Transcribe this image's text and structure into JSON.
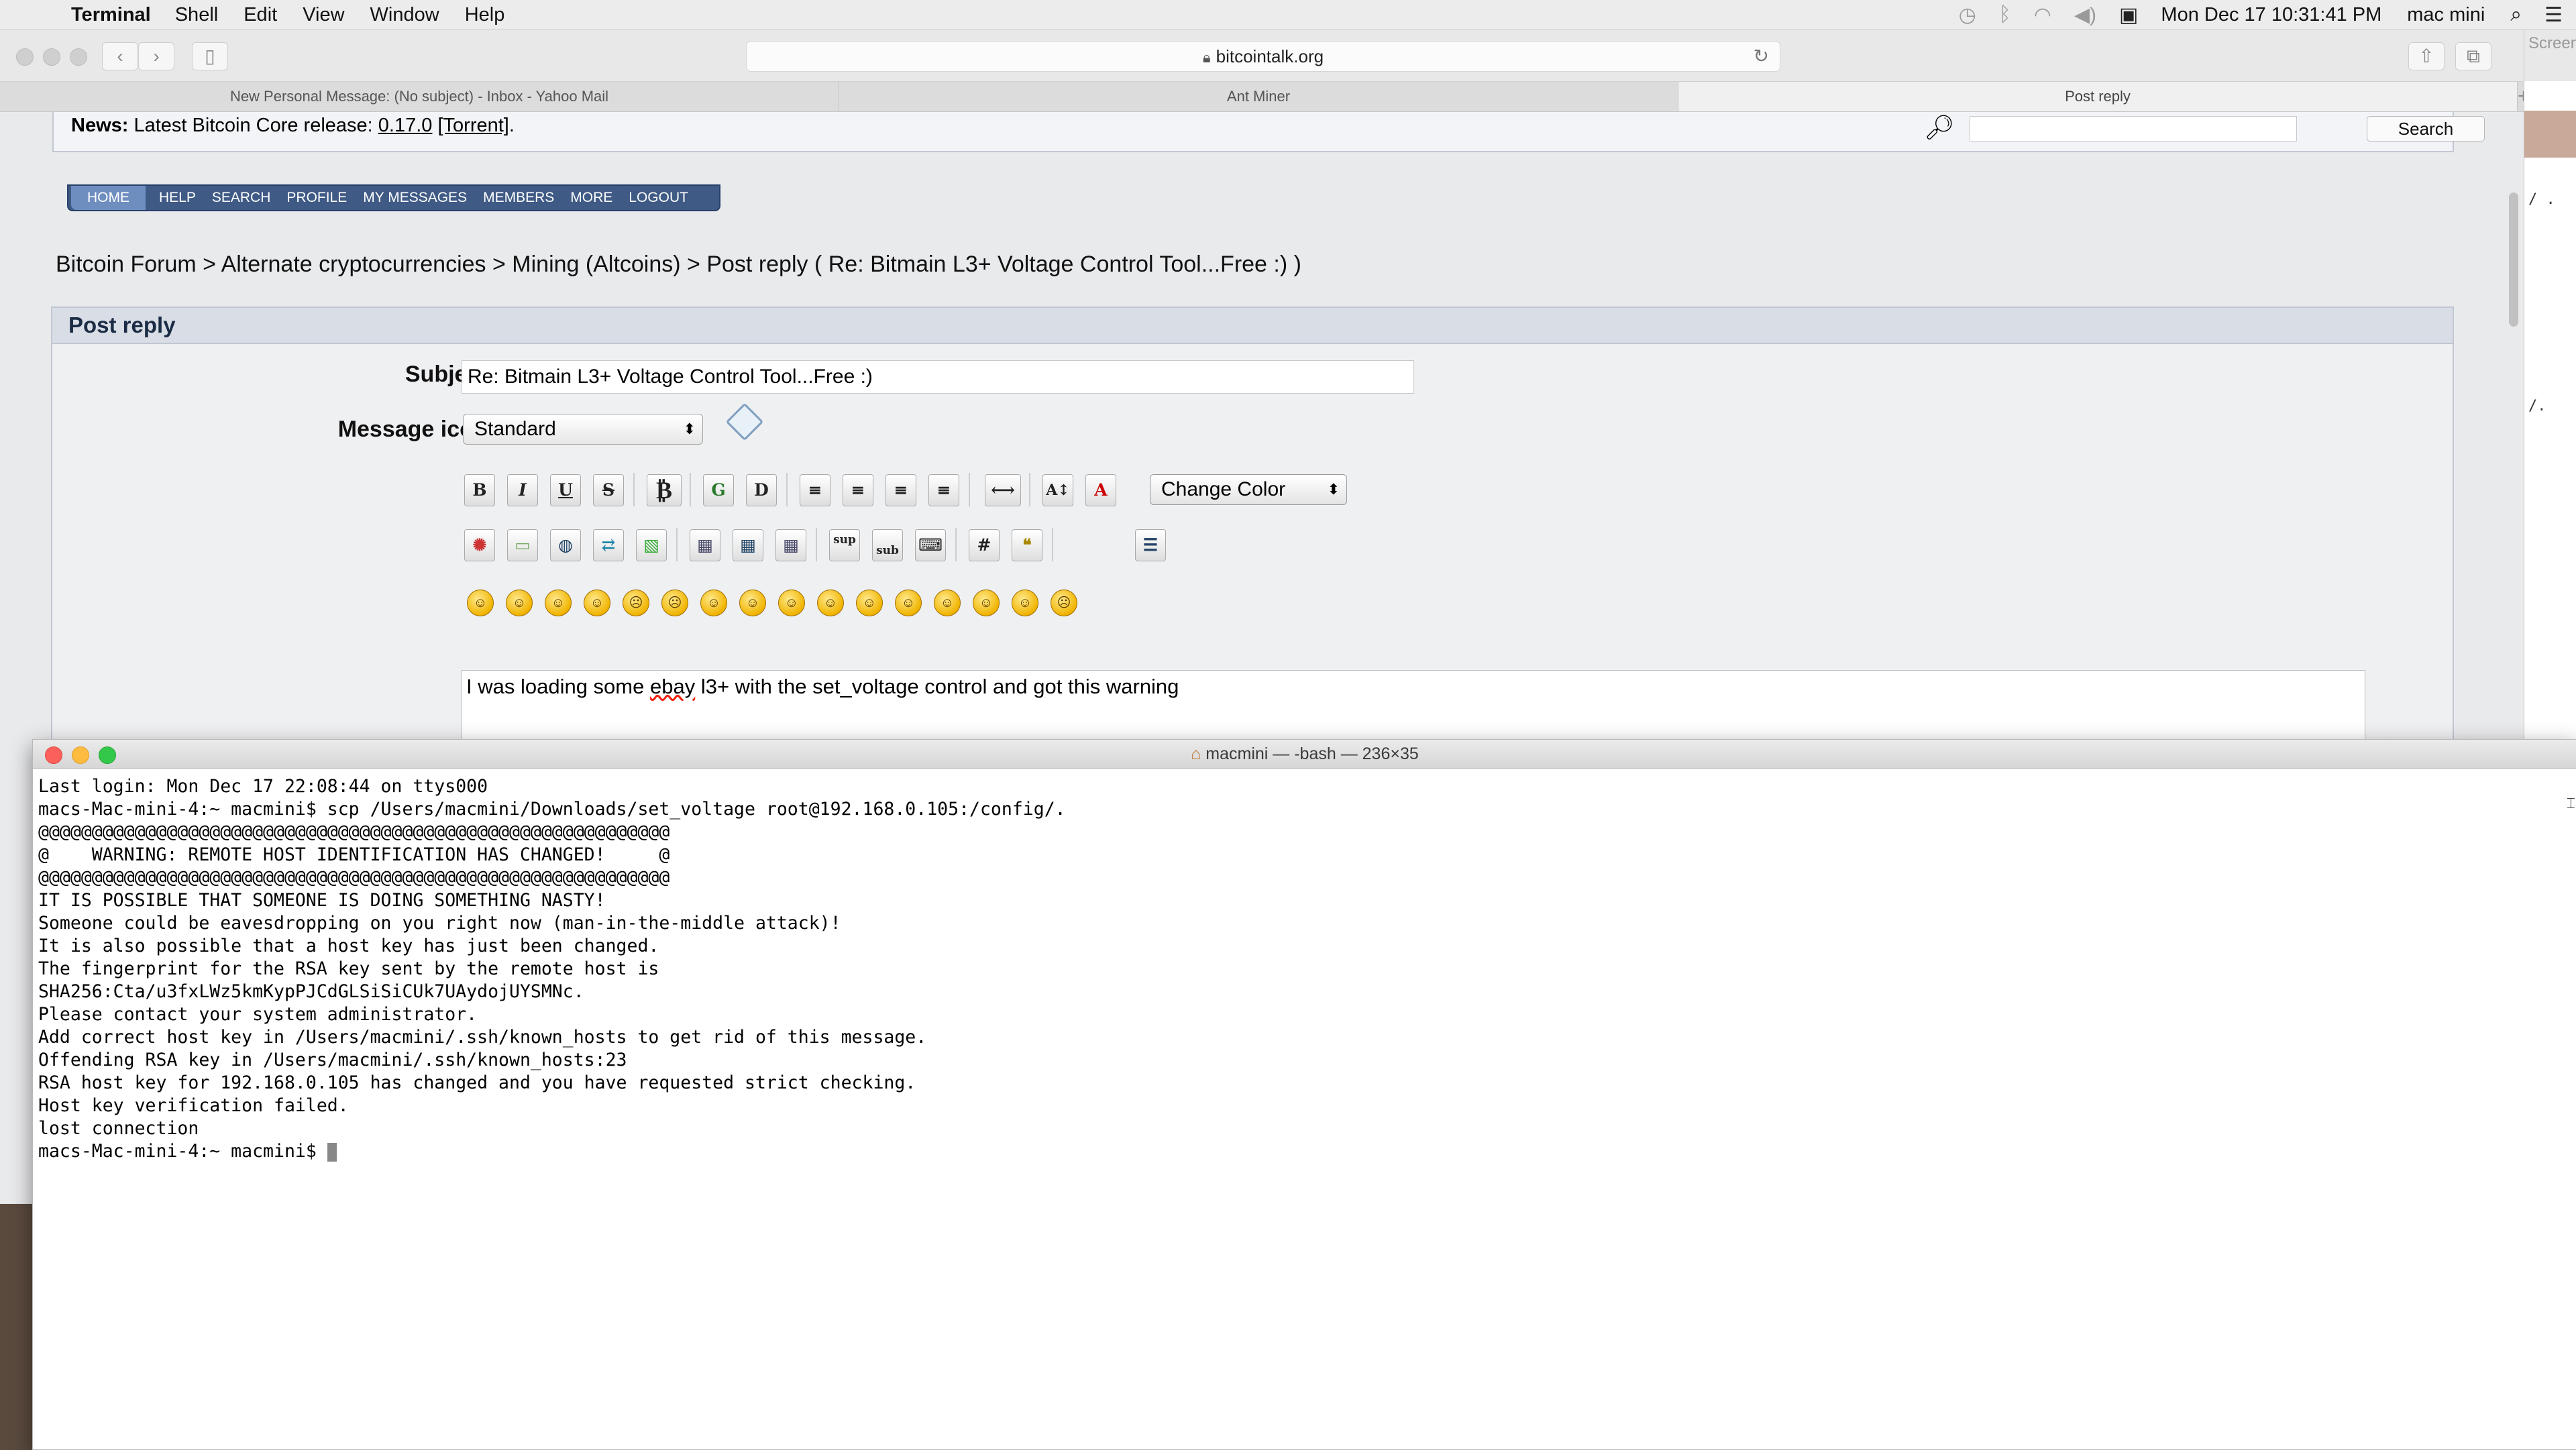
{
  "menubar": {
    "app": "Terminal",
    "items": [
      "Shell",
      "Edit",
      "View",
      "Window",
      "Help"
    ],
    "clock": "Mon Dec 17  10:31:41 PM",
    "user": "mac mini"
  },
  "safari": {
    "url": "bitcointalk.org",
    "tabs": [
      "New Personal Message: (No subject) - Inbox - Yahoo Mail",
      "Ant Miner",
      "Post reply"
    ]
  },
  "forum": {
    "news_label": "News:",
    "news_text": " Latest Bitcoin Core release: ",
    "news_version": "0.17.0",
    "news_torrent": "[Torrent]",
    "news_end": ".",
    "search_button": "Search",
    "nav": [
      "HOME",
      "HELP",
      "SEARCH",
      "PROFILE",
      "MY MESSAGES",
      "MEMBERS",
      "MORE",
      "LOGOUT"
    ],
    "breadcrumb": "Bitcoin Forum > Alternate cryptocurrencies > Mining (Altcoins) > Post reply ( Re: Bitmain L3+ Voltage Control Tool...Free :) )",
    "post_header": "Post reply",
    "subject_label": "Subject:",
    "subject_value": "Re: Bitmain L3+ Voltage Control Tool...Free :)",
    "icon_label": "Message icon:",
    "icon_value": "Standard",
    "change_color": "Change Color",
    "toolbar_row1": [
      "B",
      "I",
      "U",
      "S",
      "₿",
      "G",
      "D",
      "≡",
      "≡",
      "≡",
      "≡",
      "⟷",
      "A↕",
      "A"
    ],
    "toolbar_row2": [
      "flash",
      "img",
      "url",
      "ftp",
      "pic",
      "tbl",
      "tr",
      "td",
      "sup",
      "sub",
      "tt",
      "#",
      "quote",
      "list"
    ],
    "message_pre": "I was loading some ",
    "message_spell": "ebay",
    "message_post": " l3+  with  the  set_voltage control and got this warning"
  },
  "terminal": {
    "title": "macmini — -bash — 236×35",
    "lines": [
      "Last login: Mon Dec 17 22:08:44 on ttys000",
      "macs-Mac-mini-4:~ macmini$ scp /Users/macmini/Downloads/set_voltage root@192.168.0.105:/config/.",
      "@@@@@@@@@@@@@@@@@@@@@@@@@@@@@@@@@@@@@@@@@@@@@@@@@@@@@@@@@@@",
      "@    WARNING: REMOTE HOST IDENTIFICATION HAS CHANGED!     @",
      "@@@@@@@@@@@@@@@@@@@@@@@@@@@@@@@@@@@@@@@@@@@@@@@@@@@@@@@@@@@",
      "IT IS POSSIBLE THAT SOMEONE IS DOING SOMETHING NASTY!",
      "Someone could be eavesdropping on you right now (man-in-the-middle attack)!",
      "It is also possible that a host key has just been changed.",
      "The fingerprint for the RSA key sent by the remote host is",
      "SHA256:Cta/u3fxLWz5kmKypPJCdGLSiSiCUk7UAydojUYSMNc.",
      "Please contact your system administrator.",
      "Add correct host key in /Users/macmini/.ssh/known_hosts to get rid of this message.",
      "Offending RSA key in /Users/macmini/.ssh/known_hosts:23",
      "RSA host key for 192.168.0.105 has changed and you have requested strict checking.",
      "Host key verification failed.",
      "lost connection",
      "macs-Mac-mini-4:~ macmini$ "
    ]
  },
  "bgwin": {
    "label": "Screen",
    "line1": "/ .",
    "line2": "/."
  }
}
